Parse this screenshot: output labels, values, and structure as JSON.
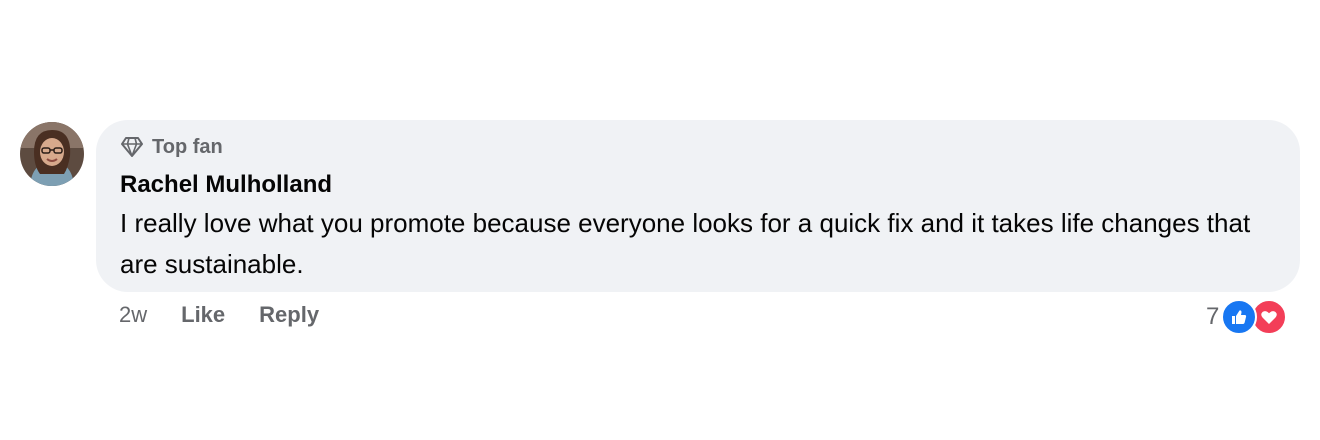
{
  "comment": {
    "badge": "Top fan",
    "author": "Rachel Mulholland",
    "text": "I really love what you promote because everyone looks for a quick fix and it takes life changes that are sustainable.",
    "timestamp": "2w",
    "actions": {
      "like": "Like",
      "reply": "Reply"
    },
    "reactions": {
      "count": "7",
      "types": [
        "like-icon",
        "love-icon"
      ]
    }
  },
  "icons": {
    "badge": "diamond-icon",
    "avatar": "profile-photo"
  },
  "colors": {
    "bubble": "#f0f2f5",
    "secondary_text": "#65676b",
    "like": "#1877f2",
    "love": "#f33e58"
  }
}
